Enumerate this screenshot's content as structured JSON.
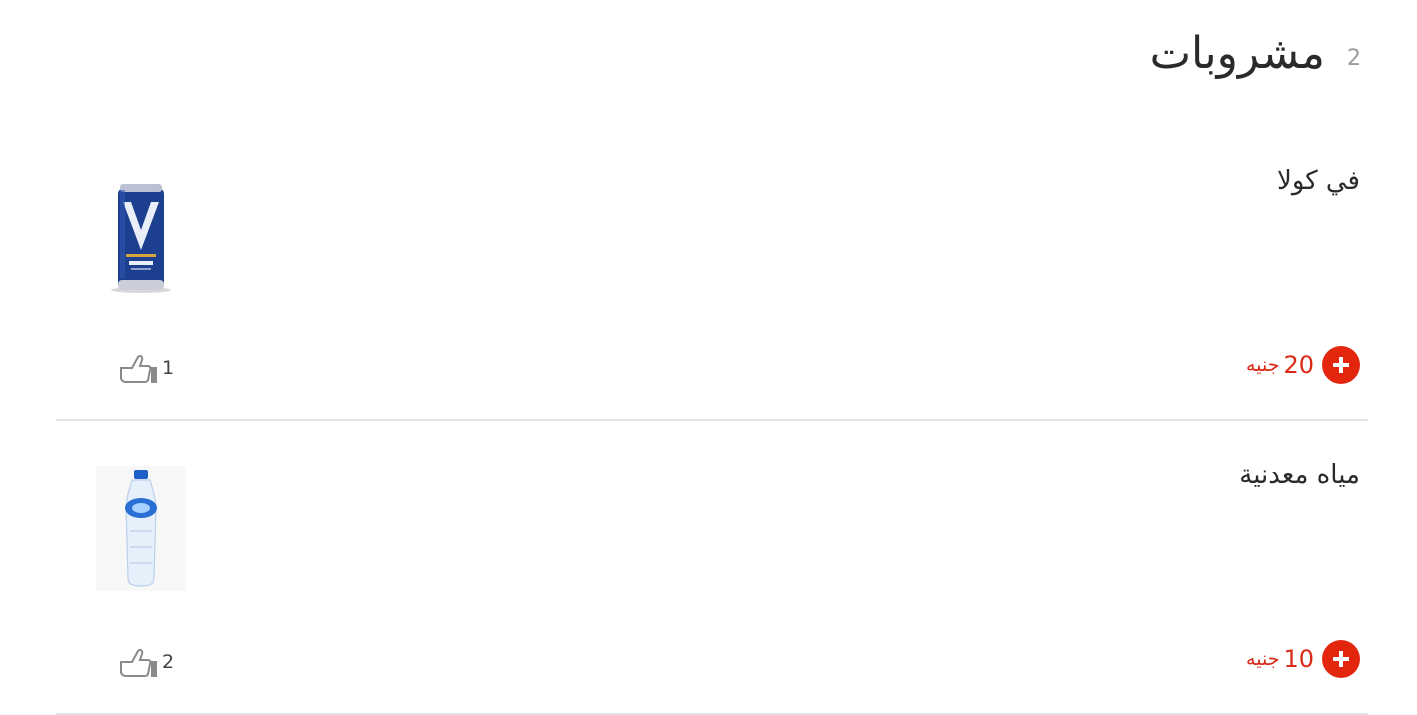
{
  "section": {
    "title": "مشروبات",
    "count": "2"
  },
  "items": [
    {
      "name": "في كولا",
      "price": "20",
      "currency": "جنيه",
      "likes": "1",
      "image_icon": "cola-can-image"
    },
    {
      "name": "مياه معدنية",
      "price": "10",
      "currency": "جنيه",
      "likes": "2",
      "image_icon": "water-bottle-image"
    }
  ],
  "colors": {
    "accent": "#e3270f",
    "price_text": "#d92b17",
    "divider": "#e3e3e3",
    "title_text": "#2a2a2a",
    "count_text": "#9a9a9a"
  }
}
